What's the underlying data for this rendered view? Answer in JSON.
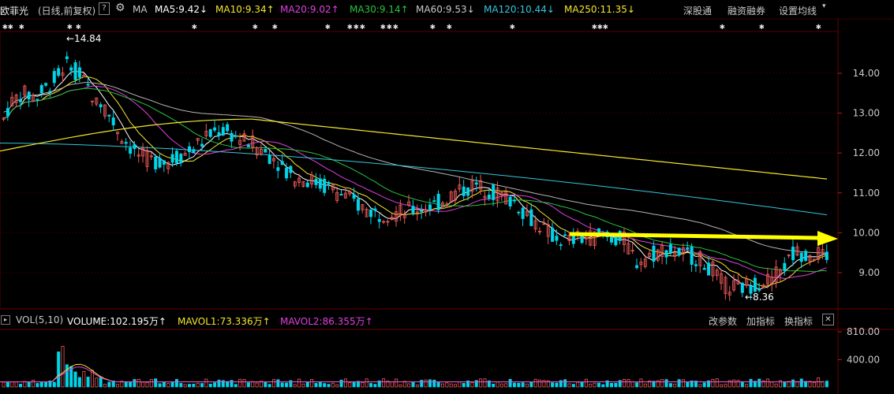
{
  "header": {
    "stock_name": "欧菲光",
    "period_label": "(日线,前复权)",
    "help_label": "?",
    "gear_icon": "gear-icon",
    "ma_label": "MA",
    "ma_items": [
      {
        "label": "MA5:9.42",
        "arrow": "↓",
        "color": "#ffffff"
      },
      {
        "label": "MA10:9.34",
        "arrow": "↑",
        "color": "#f5e62c"
      },
      {
        "label": "MA20:9.02",
        "arrow": "↑",
        "color": "#e040e0"
      },
      {
        "label": "MA30:9.14",
        "arrow": "↑",
        "color": "#27c43d"
      },
      {
        "label": "MA60:9.53",
        "arrow": "↓",
        "color": "#c8c8c8"
      },
      {
        "label": "MA120:10.44",
        "arrow": "↓",
        "color": "#34c6dc"
      },
      {
        "label": "MA250:11.35",
        "arrow": "↓",
        "color": "#f5e62c"
      }
    ],
    "right_buttons": [
      "深股通",
      "融资融券",
      "设置均线"
    ]
  },
  "markers": {
    "high_label": "←14.84",
    "low_label": "←8.36"
  },
  "price_axis": {
    "ticks": [
      "14.00",
      "13.00",
      "12.00",
      "11.00",
      "10.00",
      "9.00"
    ]
  },
  "volume_bar": {
    "label": "VOL(5,10)",
    "volume": "VOLUME:102.195万",
    "volume_arrow": "↑",
    "mavol1": "MAVOL1:73.336万",
    "mavol1_arrow": "↑",
    "mavol2": "MAVOL2:86.355万",
    "mavol2_arrow": "↑",
    "buttons": [
      "改参数",
      "加指标",
      "换指标"
    ],
    "close_label": "✕"
  },
  "volume_axis": {
    "ticks": [
      "810.00",
      "400.00"
    ]
  },
  "colors": {
    "up": "#f05a5a",
    "down": "#00d4e8",
    "arrow": "#ffff00",
    "ma5": "#ffffff",
    "ma10": "#f5e62c",
    "ma20": "#e040e0",
    "ma30": "#27c43d",
    "ma60": "#b4b4b4",
    "ma120": "#34c6dc",
    "ma250": "#f5e62c",
    "grid": "#5a0000"
  },
  "chart_data": {
    "type": "candlestick",
    "price_range": [
      8.0,
      15.0
    ],
    "high": 14.84,
    "low": 8.36,
    "volume_range": [
      0,
      810
    ],
    "ma_last": {
      "MA5": 9.42,
      "MA10": 9.34,
      "MA20": 9.02,
      "MA30": 9.14,
      "MA60": 9.53,
      "MA120": 10.44,
      "MA250": 11.35
    },
    "volume_last": 102.195,
    "mavol1_last": 73.336,
    "mavol2_last": 86.355
  }
}
